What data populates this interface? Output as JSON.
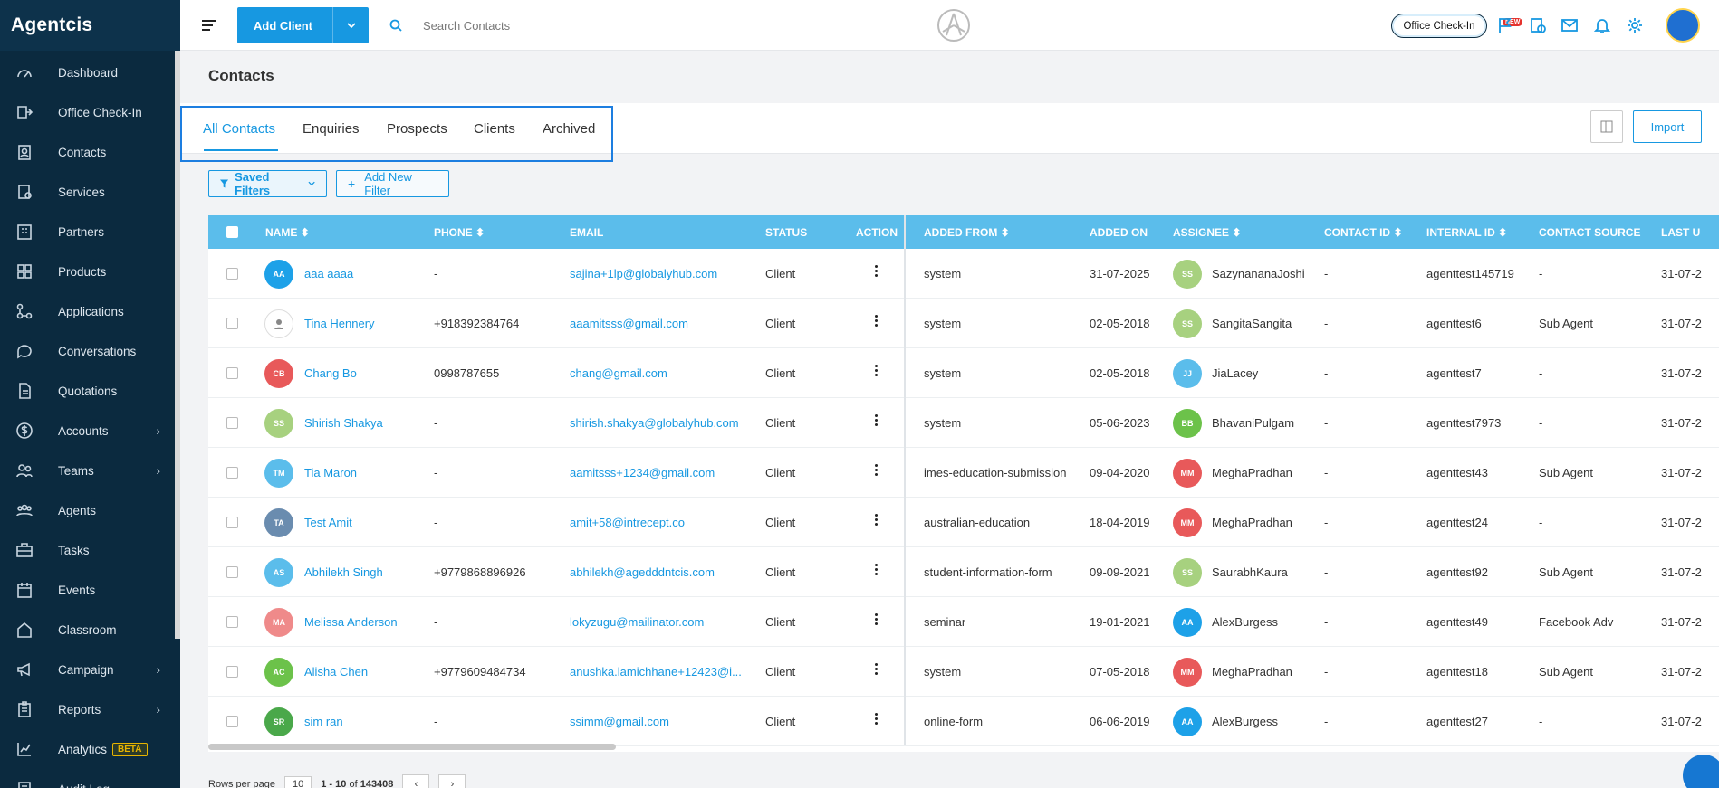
{
  "app": {
    "brand": "Agentcis"
  },
  "sidebar": {
    "items": [
      {
        "label": "Dashboard",
        "icon": "gauge-icon",
        "chevron": false
      },
      {
        "label": "Office Check-In",
        "icon": "checkin-icon",
        "chevron": false
      },
      {
        "label": "Contacts",
        "icon": "contacts-icon",
        "chevron": false
      },
      {
        "label": "Services",
        "icon": "services-icon",
        "chevron": false
      },
      {
        "label": "Partners",
        "icon": "building-icon",
        "chevron": false
      },
      {
        "label": "Products",
        "icon": "grid-icon",
        "chevron": false
      },
      {
        "label": "Applications",
        "icon": "flow-icon",
        "chevron": false
      },
      {
        "label": "Conversations",
        "icon": "chat-icon",
        "chevron": false
      },
      {
        "label": "Quotations",
        "icon": "document-icon",
        "chevron": false
      },
      {
        "label": "Accounts",
        "icon": "dollar-icon",
        "chevron": true
      },
      {
        "label": "Teams",
        "icon": "team-icon",
        "chevron": true
      },
      {
        "label": "Agents",
        "icon": "agents-icon",
        "chevron": false
      },
      {
        "label": "Tasks",
        "icon": "briefcase-icon",
        "chevron": false
      },
      {
        "label": "Events",
        "icon": "calendar-icon",
        "chevron": false
      },
      {
        "label": "Classroom",
        "icon": "home-icon",
        "chevron": false
      },
      {
        "label": "Campaign",
        "icon": "megaphone-icon",
        "chevron": true
      },
      {
        "label": "Reports",
        "icon": "clipboard-icon",
        "chevron": true
      },
      {
        "label": "Analytics",
        "icon": "chart-icon",
        "chevron": false,
        "badge": "BETA"
      },
      {
        "label": "Audit Log",
        "icon": "log-icon",
        "chevron": false
      }
    ]
  },
  "topbar": {
    "add_client_label": "Add Client",
    "search_placeholder": "Search Contacts",
    "office_checkin_label": "Office Check-In",
    "new_badge": "NEW"
  },
  "page": {
    "title": "Contacts"
  },
  "tabs": [
    "All Contacts",
    "Enquiries",
    "Prospects",
    "Clients",
    "Archived"
  ],
  "active_tab": "All Contacts",
  "import_label": "Import",
  "filters": {
    "saved_label": "Saved Filters",
    "add_label": "Add New Filter"
  },
  "table": {
    "columns": {
      "name": "NAME",
      "phone": "PHONE",
      "email": "EMAIL",
      "status": "STATUS",
      "action": "ACTION",
      "added_from": "ADDED FROM",
      "added_on": "ADDED ON",
      "assignee": "ASSIGNEE",
      "contact_id": "CONTACT ID",
      "internal_id": "INTERNAL ID",
      "contact_source": "CONTACT SOURCE",
      "last": "LAST U"
    },
    "rows": [
      {
        "initials": "AA",
        "color": "#1da1e8",
        "name": "aaa aaaa",
        "phone": "-",
        "email": "sajina+1lp@globalyhub.com",
        "status": "Client",
        "added_from": "system",
        "added_on": "31-07-2025",
        "a_initials": "SS",
        "a_color": "#a7d17f",
        "assignee": "SazynananaJoshi",
        "contact_id": "-",
        "internal_id": "agenttest145719",
        "source": "-",
        "last": "31-07-2"
      },
      {
        "initials": "",
        "color": "#ffffff",
        "name": "Tina Hennery",
        "phone": "+918392384764",
        "email": "aaamitsss@gmail.com",
        "status": "Client",
        "added_from": "system",
        "added_on": "02-05-2018",
        "a_initials": "SS",
        "a_color": "#a7d17f",
        "assignee": "SangitaSangita",
        "contact_id": "-",
        "internal_id": "agenttest6",
        "source": "Sub Agent",
        "last": "31-07-2"
      },
      {
        "initials": "CB",
        "color": "#e8595a",
        "name": "Chang Bo",
        "phone": "0998787655",
        "email": "chang@gmail.com",
        "status": "Client",
        "added_from": "system",
        "added_on": "02-05-2018",
        "a_initials": "JJ",
        "a_color": "#5bbdeb",
        "assignee": "JiaLacey",
        "contact_id": "-",
        "internal_id": "agenttest7",
        "source": "-",
        "last": "31-07-2"
      },
      {
        "initials": "SS",
        "color": "#a7d17f",
        "name": "Shirish Shakya",
        "phone": "-",
        "email": "shirish.shakya@globalyhub.com",
        "status": "Client",
        "added_from": "system",
        "added_on": "05-06-2023",
        "a_initials": "BB",
        "a_color": "#6cc24a",
        "assignee": "BhavaniPulgam",
        "contact_id": "-",
        "internal_id": "agenttest7973",
        "source": "-",
        "last": "31-07-2"
      },
      {
        "initials": "TM",
        "color": "#5bbdeb",
        "name": "Tia Maron",
        "phone": "-",
        "email": "aamitsss+1234@gmail.com",
        "status": "Client",
        "added_from": "imes-education-submission",
        "added_on": "09-04-2020",
        "a_initials": "MM",
        "a_color": "#e8595a",
        "assignee": "MeghaPradhan",
        "contact_id": "-",
        "internal_id": "agenttest43",
        "source": "Sub Agent",
        "last": "31-07-2"
      },
      {
        "initials": "TA",
        "color": "#6a8caf",
        "name": "Test Amit",
        "phone": "-",
        "email": "amit+58@intrecept.co",
        "status": "Client",
        "added_from": "australian-education",
        "added_on": "18-04-2019",
        "a_initials": "MM",
        "a_color": "#e8595a",
        "assignee": "MeghaPradhan",
        "contact_id": "-",
        "internal_id": "agenttest24",
        "source": "-",
        "last": "31-07-2"
      },
      {
        "initials": "AS",
        "color": "#5bbdeb",
        "name": "Abhilekh Singh",
        "phone": "+9779868896926",
        "email": "abhilekh@agedddntcis.com",
        "status": "Client",
        "added_from": "student-information-form",
        "added_on": "09-09-2021",
        "a_initials": "SS",
        "a_color": "#a7d17f",
        "assignee": "SaurabhKaura",
        "contact_id": "-",
        "internal_id": "agenttest92",
        "source": "Sub Agent",
        "last": "31-07-2"
      },
      {
        "initials": "MA",
        "color": "#ef8a8a",
        "name": "Melissa Anderson",
        "phone": "-",
        "email": "lokyzugu@mailinator.com",
        "status": "Client",
        "added_from": "seminar",
        "added_on": "19-01-2021",
        "a_initials": "AA",
        "a_color": "#1da1e8",
        "assignee": "AlexBurgess",
        "contact_id": "-",
        "internal_id": "agenttest49",
        "source": "Facebook Adv",
        "last": "31-07-2"
      },
      {
        "initials": "AC",
        "color": "#6cc24a",
        "name": "Alisha Chen",
        "phone": "+9779609484734",
        "email": "anushka.lamichhane+12423@i...",
        "status": "Client",
        "added_from": "system",
        "added_on": "07-05-2018",
        "a_initials": "MM",
        "a_color": "#e8595a",
        "assignee": "MeghaPradhan",
        "contact_id": "-",
        "internal_id": "agenttest18",
        "source": "Sub Agent",
        "last": "31-07-2"
      },
      {
        "initials": "SR",
        "color": "#4aa84a",
        "name": "sim ran",
        "phone": "-",
        "email": "ssimm@gmail.com",
        "status": "Client",
        "added_from": "online-form",
        "added_on": "06-06-2019",
        "a_initials": "AA",
        "a_color": "#1da1e8",
        "assignee": "AlexBurgess",
        "contact_id": "-",
        "internal_id": "agenttest27",
        "source": "-",
        "last": "31-07-2"
      }
    ]
  },
  "footer": {
    "rows_per_page_label": "Rows per page",
    "rows_per_page": "10",
    "range": "1 - 10",
    "of_label": "of",
    "total": "143408"
  }
}
